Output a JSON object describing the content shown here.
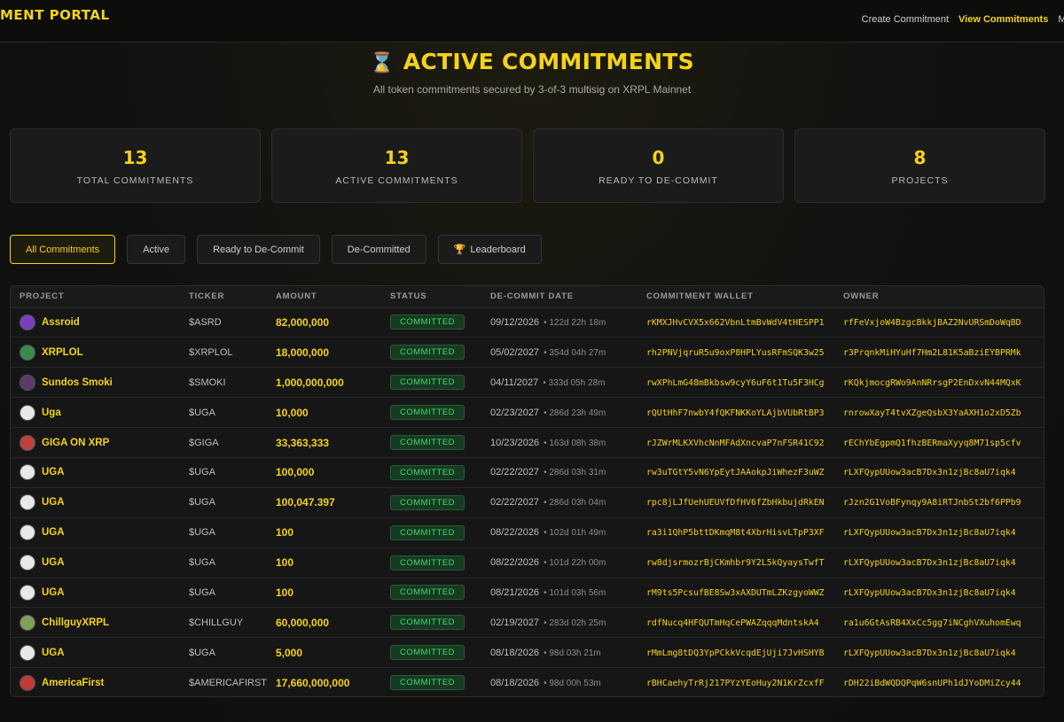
{
  "header": {
    "brand": "MENT PORTAL",
    "nav": [
      {
        "label": "Create Commitment",
        "active": false
      },
      {
        "label": "View Commitments",
        "active": true
      },
      {
        "label": "My",
        "active": false
      }
    ]
  },
  "hero": {
    "icon": "hourglass-icon",
    "title": "ACTIVE COMMITMENTS",
    "subtitle": "All token commitments secured by 3-of-3 multisig on XRPL Mainnet"
  },
  "stats": [
    {
      "value": "13",
      "label": "TOTAL COMMITMENTS"
    },
    {
      "value": "13",
      "label": "ACTIVE COMMITMENTS"
    },
    {
      "value": "0",
      "label": "READY TO DE-COMMIT"
    },
    {
      "value": "8",
      "label": "PROJECTS"
    }
  ],
  "tabs": [
    {
      "label": "All Commitments",
      "active": true,
      "icon": ""
    },
    {
      "label": "Active",
      "active": false,
      "icon": ""
    },
    {
      "label": "Ready to De-Commit",
      "active": false,
      "icon": ""
    },
    {
      "label": "De-Committed",
      "active": false,
      "icon": ""
    },
    {
      "label": "Leaderboard",
      "active": false,
      "icon": "trophy-icon"
    }
  ],
  "table": {
    "columns": [
      "PROJECT",
      "TICKER",
      "AMOUNT",
      "STATUS",
      "DE-COMMIT DATE",
      "COMMITMENT WALLET",
      "OWNER"
    ],
    "rows": [
      {
        "project": "Assroid",
        "ticker": "$ASRD",
        "amount": "82,000,000",
        "status": "COMMITTED",
        "date": "09/12/2026",
        "remaining": "• 122d 22h 18m",
        "wallet": "rKMXJHvCVX5x662VbnLtmBvWdV4tHESPP1",
        "owner": "rfFeVxjoW4BzgcBkkjBAZ2NvURSmDoWqBD",
        "avatar_color": "#7a3fc0"
      },
      {
        "project": "XRPLOL",
        "ticker": "$XRPLOL",
        "amount": "18,000,000",
        "status": "COMMITTED",
        "date": "05/02/2027",
        "remaining": "• 354d 04h 27m",
        "wallet": "rh2PNVjqruR5u9oxP8HPLYusRFmSQK3w25",
        "owner": "r3PrqnkMiHYuHf7Hm2L81K5aBziEYBPRMk",
        "avatar_color": "#3a8a4a"
      },
      {
        "project": "Sundos Smoki",
        "ticker": "$SMOKI",
        "amount": "1,000,000,000",
        "status": "COMMITTED",
        "date": "04/11/2027",
        "remaining": "• 333d 05h 28m",
        "wallet": "rwXPhLmG48mBkbsw9cyY6uF6t1Tu5F3HCg",
        "owner": "rKQkjmocgRWo9AnNRrsgP2EnDxvN44MQxK",
        "avatar_color": "#5a3a6a"
      },
      {
        "project": "Uga",
        "ticker": "$UGA",
        "amount": "10,000",
        "status": "COMMITTED",
        "date": "02/23/2027",
        "remaining": "• 286d 23h 49m",
        "wallet": "rQUtHhF7nwbY4fQKFNKKoYLAjbVUbRtBP3",
        "owner": "rnrowXayT4tvXZgeQsbX3YaAXH1o2xD5Zb",
        "avatar_color": "#e8e8e8"
      },
      {
        "project": "GIGA ON XRP",
        "ticker": "$GIGA",
        "amount": "33,363,333",
        "status": "COMMITTED",
        "date": "10/23/2026",
        "remaining": "• 163d 08h 38m",
        "wallet": "rJZWrMLKXVhcNnMFAdXncvaP7nFSR41C92",
        "owner": "rEChYbEgpmQ1fhzBERmaXyyq8M71sp5cfv",
        "avatar_color": "#c04040"
      },
      {
        "project": "UGA",
        "ticker": "$UGA",
        "amount": "100,000",
        "status": "COMMITTED",
        "date": "02/22/2027",
        "remaining": "• 286d 03h 31m",
        "wallet": "rw3uTGtY5vN6YpEytJAAokpJiWhezF3uWZ",
        "owner": "rLXFQypUUow3acB7Dx3n1zjBc8aU7iqk4",
        "avatar_color": "#e8e8e8"
      },
      {
        "project": "UGA",
        "ticker": "$UGA",
        "amount": "100,047.397",
        "status": "COMMITTED",
        "date": "02/22/2027",
        "remaining": "• 286d 03h 04m",
        "wallet": "rpc8jLJfUehUEUVfDfHV6fZbHkbujdRkEN",
        "owner": "rJzn2G1VoBFynqy9A8iRTJnbSt2bf6PPb9",
        "avatar_color": "#e8e8e8"
      },
      {
        "project": "UGA",
        "ticker": "$UGA",
        "amount": "100",
        "status": "COMMITTED",
        "date": "08/22/2026",
        "remaining": "• 102d 01h 49m",
        "wallet": "ra3i1QhP5bttDKmqM8t4XbrHisvLTpP3XF",
        "owner": "rLXFQypUUow3acB7Dx3n1zjBc8aU7iqk4",
        "avatar_color": "#e8e8e8"
      },
      {
        "project": "UGA",
        "ticker": "$UGA",
        "amount": "100",
        "status": "COMMITTED",
        "date": "08/22/2026",
        "remaining": "• 101d 22h 00m",
        "wallet": "rw8djsrmozrBjCKmhbr9Y2L5kQyaysTwfT",
        "owner": "rLXFQypUUow3acB7Dx3n1zjBc8aU7iqk4",
        "avatar_color": "#e8e8e8"
      },
      {
        "project": "UGA",
        "ticker": "$UGA",
        "amount": "100",
        "status": "COMMITTED",
        "date": "08/21/2026",
        "remaining": "• 101d 03h 56m",
        "wallet": "rM9ts5PcsufBE8Sw3xAXDUTmLZKzgyoWWZ",
        "owner": "rLXFQypUUow3acB7Dx3n1zjBc8aU7iqk4",
        "avatar_color": "#e8e8e8"
      },
      {
        "project": "ChillguyXRPL",
        "ticker": "$CHILLGUY",
        "amount": "60,000,000",
        "status": "COMMITTED",
        "date": "02/19/2027",
        "remaining": "• 283d 02h 25m",
        "wallet": "rdfNucq4HFQUTmHqCePWAZqqqMdntskA4",
        "owner": "ra1u6GtAsRB4XxCc5gg7iNCghVXuhomEwq",
        "avatar_color": "#7fa05a"
      },
      {
        "project": "UGA",
        "ticker": "$UGA",
        "amount": "5,000",
        "status": "COMMITTED",
        "date": "08/18/2026",
        "remaining": "• 98d 03h 21m",
        "wallet": "rMmLmg8tDQ3YpPCkkVcqdEjUji7JvHSHYB",
        "owner": "rLXFQypUUow3acB7Dx3n1zjBc8aU7iqk4",
        "avatar_color": "#e8e8e8"
      },
      {
        "project": "AmericaFirst",
        "ticker": "$AMERICAFIRST",
        "amount": "17,660,000,000",
        "status": "COMMITTED",
        "date": "08/18/2026",
        "remaining": "• 98d 00h 53m",
        "wallet": "rBHCaehyTrRj217PYzYEoHuy2N1KrZcxfF",
        "owner": "rDH22iBdWQDQPqW6snUPh1dJYoDMiZcy44",
        "avatar_color": "#c03a3a"
      }
    ]
  },
  "colors": {
    "accent": "#f5d316",
    "status_green": "#3fdc6a",
    "background": "#0e0e0e"
  }
}
